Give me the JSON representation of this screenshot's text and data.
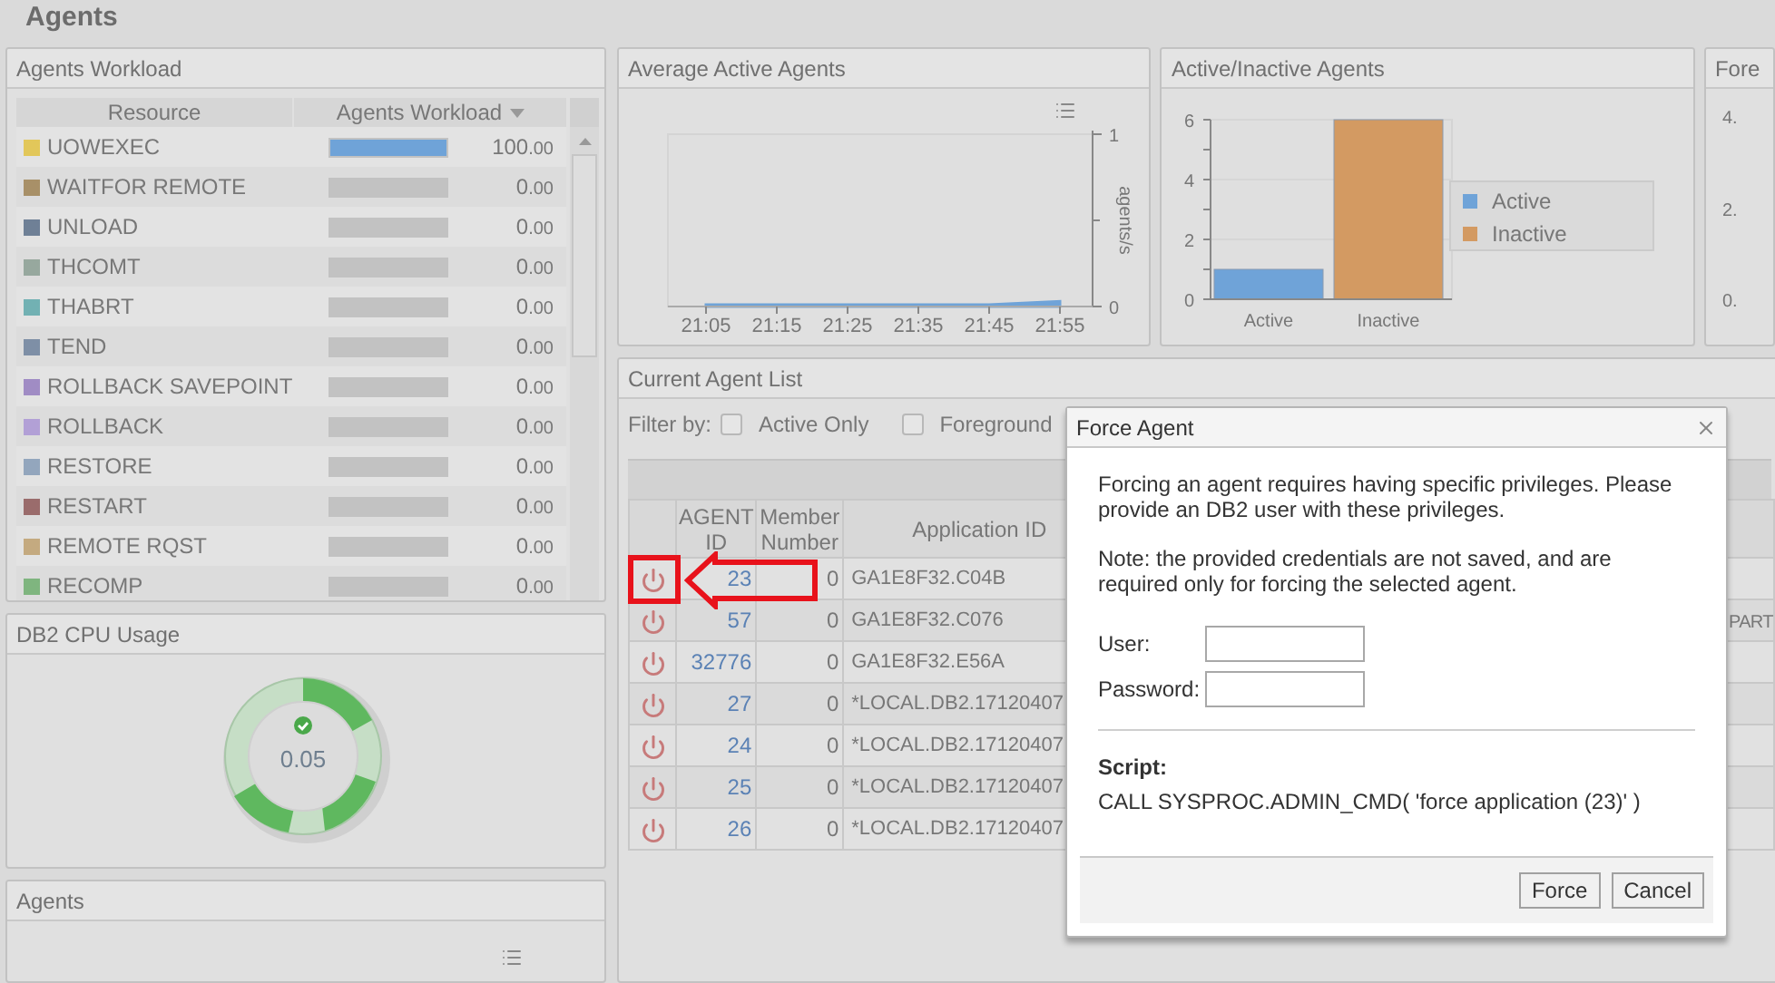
{
  "page_title": "Agents",
  "workload": {
    "title": "Agents Workload",
    "columns": [
      {
        "label": "Resource",
        "sorted": false
      },
      {
        "label": "Agents Workload",
        "sorted": true
      }
    ],
    "rows": [
      {
        "name": "UOWEXEC",
        "color": "#e2c75a",
        "level": 1,
        "value": "100",
        "fraction": ".00"
      },
      {
        "name": "WAITFOR REMOTE",
        "color": "#a89068",
        "level": 0,
        "value": "0",
        "fraction": ".00"
      },
      {
        "name": "UNLOAD",
        "color": "#6f8096",
        "level": 0,
        "value": "0",
        "fraction": ".00"
      },
      {
        "name": "THCOMT",
        "color": "#97a89e",
        "level": 0,
        "value": "0",
        "fraction": ".00"
      },
      {
        "name": "THABRT",
        "color": "#72b1b3",
        "level": 0,
        "value": "0",
        "fraction": ".00"
      },
      {
        "name": "TEND",
        "color": "#7e8fa6",
        "level": 0,
        "value": "0",
        "fraction": ".00"
      },
      {
        "name": "ROLLBACK SAVEPOINT",
        "color": "#a08cc4",
        "level": 0,
        "value": "0",
        "fraction": ".00"
      },
      {
        "name": "ROLLBACK",
        "color": "#b2a0d6",
        "level": 0,
        "value": "0",
        "fraction": ".00"
      },
      {
        "name": "RESTORE",
        "color": "#93a6bd",
        "level": 0,
        "value": "0",
        "fraction": ".00"
      },
      {
        "name": "RESTART",
        "color": "#9a6c6c",
        "level": 0,
        "value": "0",
        "fraction": ".00"
      },
      {
        "name": "REMOTE RQST",
        "color": "#c4aa80",
        "level": 0,
        "value": "0",
        "fraction": ".00"
      },
      {
        "name": "RECOMP",
        "color": "#7fb57f",
        "level": 0,
        "value": "0",
        "fraction": ".00"
      }
    ]
  },
  "cpu": {
    "title": "DB2 CPU Usage",
    "value": "0.05"
  },
  "agents_panel": {
    "title": "Agents"
  },
  "avg_chart": {
    "title": "Average Active Agents",
    "chart_data": {
      "type": "area",
      "ylabel": "agents/s",
      "categories": [
        "21:05",
        "21:15",
        "21:25",
        "21:35",
        "21:45",
        "21:55"
      ],
      "series": [
        {
          "color": "#6fa3d8",
          "values": [
            0.01,
            0.01,
            0.01,
            0.01,
            0.01,
            0.03
          ]
        }
      ],
      "ylim": [
        0,
        1
      ],
      "yticks": [
        0,
        1
      ]
    }
  },
  "active_chart": {
    "title": "Active/Inactive Agents",
    "chart_data": {
      "type": "bar",
      "categories": [
        "Active",
        "Inactive"
      ],
      "series": [
        {
          "name": "Active",
          "color": "#6fa3d8",
          "values": [
            1,
            null
          ]
        },
        {
          "name": "Inactive",
          "color": "#d39a62",
          "values": [
            null,
            6
          ]
        }
      ],
      "ylim": [
        0,
        6
      ],
      "yticks": [
        0,
        2,
        4,
        6
      ]
    }
  },
  "fore_panel": {
    "title": "Fore",
    "axis_labels": [
      "4.",
      "2.",
      "0."
    ]
  },
  "agent_list": {
    "title": "Current Agent List",
    "filter_label": "Filter by:",
    "filters": [
      {
        "label": "Active Only",
        "checked": false
      },
      {
        "label": "Foreground",
        "checked": false
      }
    ],
    "columns": [
      "AGENT ID",
      "Member Number",
      "Application ID"
    ],
    "rows": [
      {
        "agent_id": "23",
        "member": "0",
        "application_id": "GA1E8F32.C04B"
      },
      {
        "agent_id": "57",
        "member": "0",
        "application_id": "GA1E8F32.C076",
        "column_5": "PART"
      },
      {
        "agent_id": "32776",
        "member": "0",
        "application_id": "GA1E8F32.E56A"
      },
      {
        "agent_id": "27",
        "member": "0",
        "application_id": "*LOCAL.DB2.17120407"
      },
      {
        "agent_id": "24",
        "member": "0",
        "application_id": "*LOCAL.DB2.17120407"
      },
      {
        "agent_id": "25",
        "member": "0",
        "application_id": "*LOCAL.DB2.17120407"
      },
      {
        "agent_id": "26",
        "member": "0",
        "application_id": "*LOCAL.DB2.17120407"
      }
    ]
  },
  "dialog": {
    "title": "Force Agent",
    "message": "Forcing an agent requires having specific privileges. Please provide an DB2 user with these privileges.",
    "note": "Note: the provided credentials are not saved, and are required only for forcing the selected agent.",
    "fields": [
      {
        "label": "User:"
      },
      {
        "label": "Password:"
      }
    ],
    "script_label": "Script:",
    "script": "CALL SYSPROC.ADMIN_CMD( 'force application (23)' )",
    "buttons": [
      "Force",
      "Cancel"
    ]
  }
}
